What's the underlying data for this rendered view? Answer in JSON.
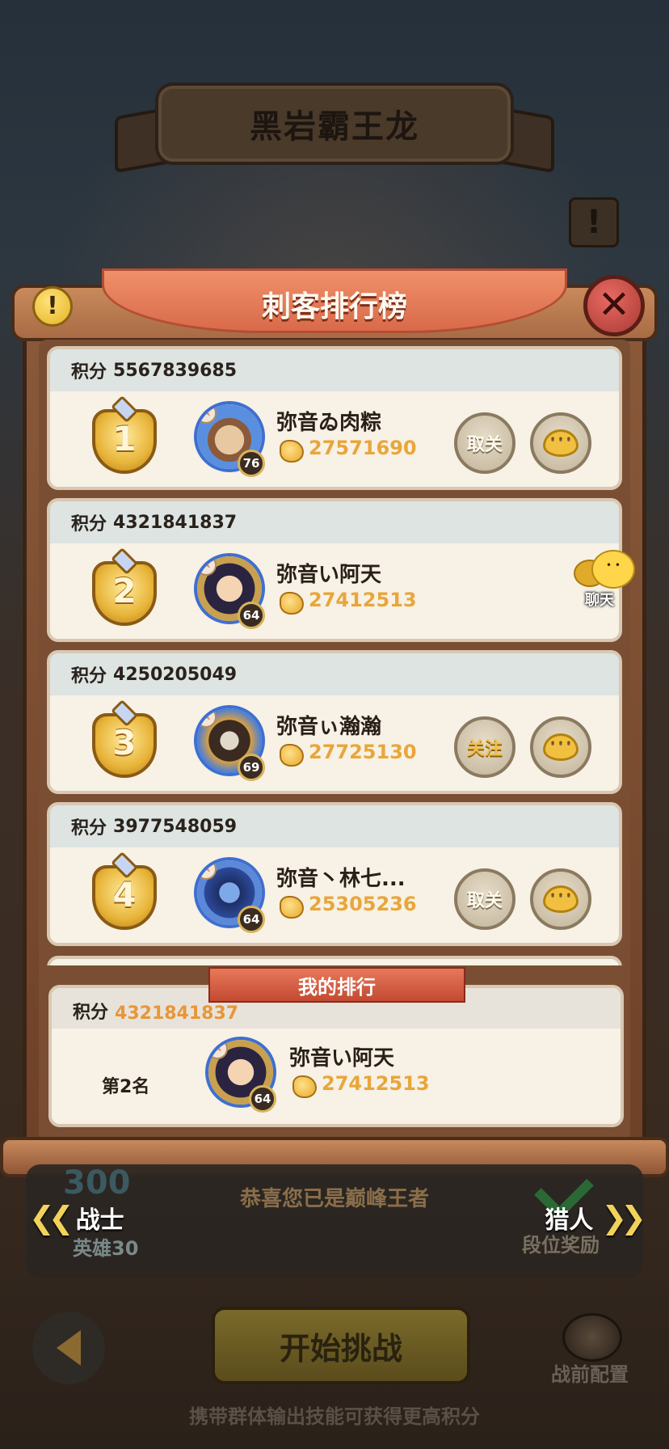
{
  "title_banner": "黑岩霸王龙",
  "panel_title": "刺客排行榜",
  "score_label": "积分",
  "ranking": [
    {
      "rank": "1",
      "score": "5567839685",
      "name": "弥音ゐ肉粽",
      "level": "76",
      "power": "27571690",
      "action": "取关"
    },
    {
      "rank": "2",
      "score": "4321841837",
      "name": "弥音い阿天",
      "level": "64",
      "power": "27412513",
      "action": ""
    },
    {
      "rank": "3",
      "score": "4250205049",
      "name": "弥音ぃ瀚瀚",
      "level": "69",
      "power": "27725130",
      "action": "关注"
    },
    {
      "rank": "4",
      "score": "3977548059",
      "name": "弥音丶林七...",
      "level": "64",
      "power": "25305236",
      "action": "取关"
    }
  ],
  "floating_chat_label": "聊天",
  "my_rank": {
    "tag": "我的排行",
    "score": "4321841837",
    "rank_text": "第2名",
    "name": "弥音い阿天",
    "level": "64",
    "power": "27412513"
  },
  "lower": {
    "medal_value": "300",
    "congrats": "恭喜您已是巅峰王者",
    "prev_label": "战士",
    "next_label": "猎人",
    "hero_count": "英雄30",
    "rank_reward": "段位奖励",
    "start": "开始挑战",
    "pre_config": "战前配置",
    "tip": "携带群体输出技能可获得更高积分"
  },
  "colors": {
    "panel_ribbon": "#e07a58",
    "power_text": "#e8a63a",
    "follow_text": "#f2c04a"
  }
}
